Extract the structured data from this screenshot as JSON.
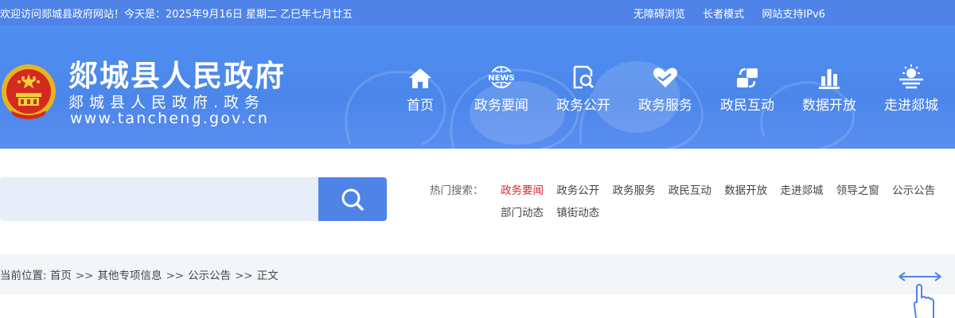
{
  "topbar": {
    "welcome": "欢迎访问郯城县政府网站！今天是：2025年9月16日  星期二  乙巳年七月廿五",
    "links": [
      "无障碍浏览",
      "长者模式",
      "网站支持IPv6"
    ]
  },
  "header": {
    "site_title": "郯城县人民政府",
    "site_subtitle": "郯城县人民政府.政务",
    "site_url": "www.tancheng.gov.cn",
    "icon_news_text": "NEWS"
  },
  "nav": [
    {
      "label": "首页",
      "icon": "home-icon"
    },
    {
      "label": "政务要闻",
      "icon": "news-globe-icon"
    },
    {
      "label": "政务公开",
      "icon": "document-search-icon"
    },
    {
      "label": "政务服务",
      "icon": "heart-hand-icon"
    },
    {
      "label": "政民互动",
      "icon": "exchange-icon"
    },
    {
      "label": "数据开放",
      "icon": "bar-chart-icon"
    },
    {
      "label": "走进郯城",
      "icon": "sun-landscape-icon"
    }
  ],
  "search": {
    "placeholder": "",
    "hot_label": "热门搜索：",
    "hot_terms": [
      "政务要闻",
      "政务公开",
      "政务服务",
      "政民互动",
      "数据开放",
      "走进郯城",
      "领导之窗",
      "公示公告",
      "部门动态",
      "镇街动态"
    ]
  },
  "breadcrumb": {
    "prefix": "当前位置: ",
    "items": [
      "首页",
      "其他专项信息",
      "公示公告",
      "正文"
    ],
    "separator": ">>"
  },
  "colors": {
    "primary": "#4f83e8",
    "header_bg": "#4e8ff0",
    "active_term": "#d9272e",
    "search_bg": "#e7eefa",
    "crumb_bg": "#f3f6f9"
  }
}
